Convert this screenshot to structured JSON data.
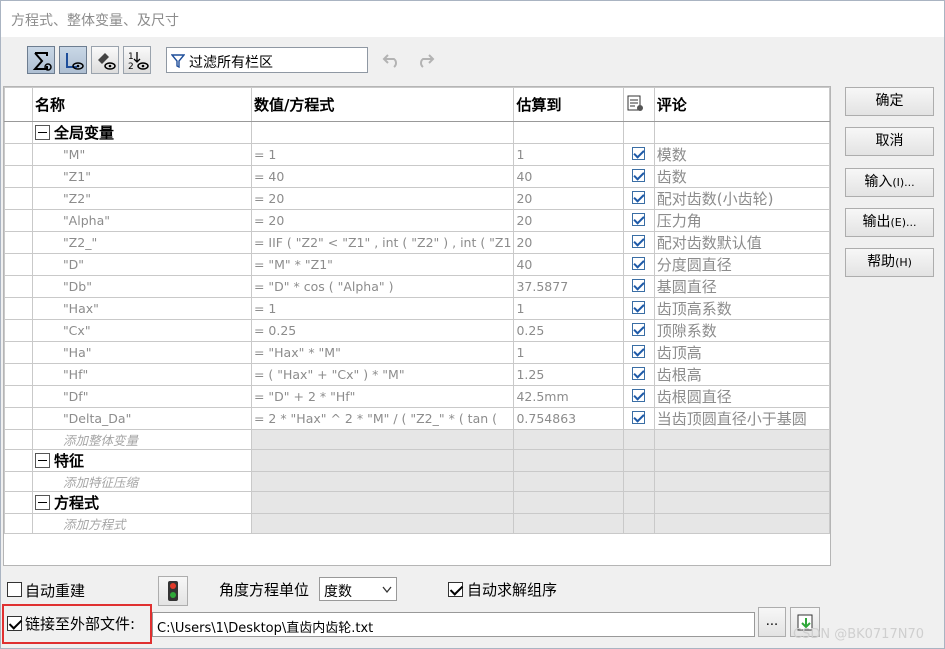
{
  "window": {
    "title": "方程式、整体变量、及尺寸"
  },
  "toolbar": {
    "buttons": [
      {
        "name": "sigma-icon",
        "pressed": true
      },
      {
        "name": "view-equations-icon",
        "pressed": true
      },
      {
        "name": "dimension-view-icon",
        "pressed": false
      },
      {
        "name": "sort-order-icon",
        "pressed": false
      }
    ],
    "filter_text": "过滤所有栏区",
    "undo_icon": "undo-icon",
    "redo_icon": "redo-icon"
  },
  "grid": {
    "headers": {
      "name": "名称",
      "value": "数值/方程式",
      "eval": "估算到",
      "comment": "评论"
    },
    "groups": {
      "globals": "全局变量",
      "features": "特征",
      "equations": "方程式"
    },
    "rows": [
      {
        "name": "\"M\"",
        "value": "= 1",
        "eval": "1",
        "comment": "模数"
      },
      {
        "name": "\"Z1\"",
        "value": "= 40",
        "eval": "40",
        "comment": "齿数"
      },
      {
        "name": "\"Z2\"",
        "value": "= 20",
        "eval": "20",
        "comment": "配对齿数(小齿轮)"
      },
      {
        "name": "\"Alpha\"",
        "value": "= 20",
        "eval": "20",
        "comment": "压力角"
      },
      {
        "name": "\"Z2_\"",
        "value": "= IIF ( \"Z2\" < \"Z1\" , int ( \"Z2\" ) , int ( \"Z1",
        "eval": "20",
        "comment": "配对齿数默认值"
      },
      {
        "name": "\"D\"",
        "value": "= \"M\" * \"Z1\"",
        "eval": "40",
        "comment": "分度圆直径"
      },
      {
        "name": "\"Db\"",
        "value": "= \"D\" * cos ( \"Alpha\" )",
        "eval": "37.5877",
        "comment": "基圆直径"
      },
      {
        "name": "\"Hax\"",
        "value": "= 1",
        "eval": "1",
        "comment": "齿顶高系数"
      },
      {
        "name": "\"Cx\"",
        "value": "= 0.25",
        "eval": "0.25",
        "comment": "顶隙系数"
      },
      {
        "name": "\"Ha\"",
        "value": "= \"Hax\" * \"M\"",
        "eval": "1",
        "comment": "齿顶高"
      },
      {
        "name": "\"Hf\"",
        "value": "= ( \"Hax\" + \"Cx\" ) * \"M\"",
        "eval": "1.25",
        "comment": "齿根高"
      },
      {
        "name": "\"Df\"",
        "value": "= \"D\" + 2 * \"Hf\"",
        "eval": "42.5mm",
        "comment": "齿根圆直径"
      },
      {
        "name": "\"Delta_Da\"",
        "value": "= 2 * \"Hax\" ^ 2 * \"M\" / ( \"Z2_\" * ( tan (",
        "eval": "0.754863",
        "comment": "当齿顶圆直径小于基圆"
      }
    ],
    "add_global": "添加整体变量",
    "add_feature": "添加特征压缩",
    "add_equation": "添加方程式"
  },
  "side_buttons": {
    "ok": "确定",
    "cancel": "取消",
    "import": "输入",
    "import_key": "(I)...",
    "export": "输出",
    "export_key": "(E)...",
    "help": "帮助",
    "help_key": "(H)"
  },
  "bottom": {
    "auto_rebuild": "自动重建",
    "angle_unit_label": "角度方程单位",
    "angle_unit_value": "度数",
    "auto_solve": "自动求解组序",
    "link_label": "链接至外部文件:",
    "link_path": "C:\\Users\\1\\Desktop\\直齿内齿轮.txt",
    "browse": "...",
    "watermark": "CSDN @BK0717N70"
  },
  "colors": {
    "highlight_box": "#e03030",
    "check": "#1e5aa8"
  }
}
